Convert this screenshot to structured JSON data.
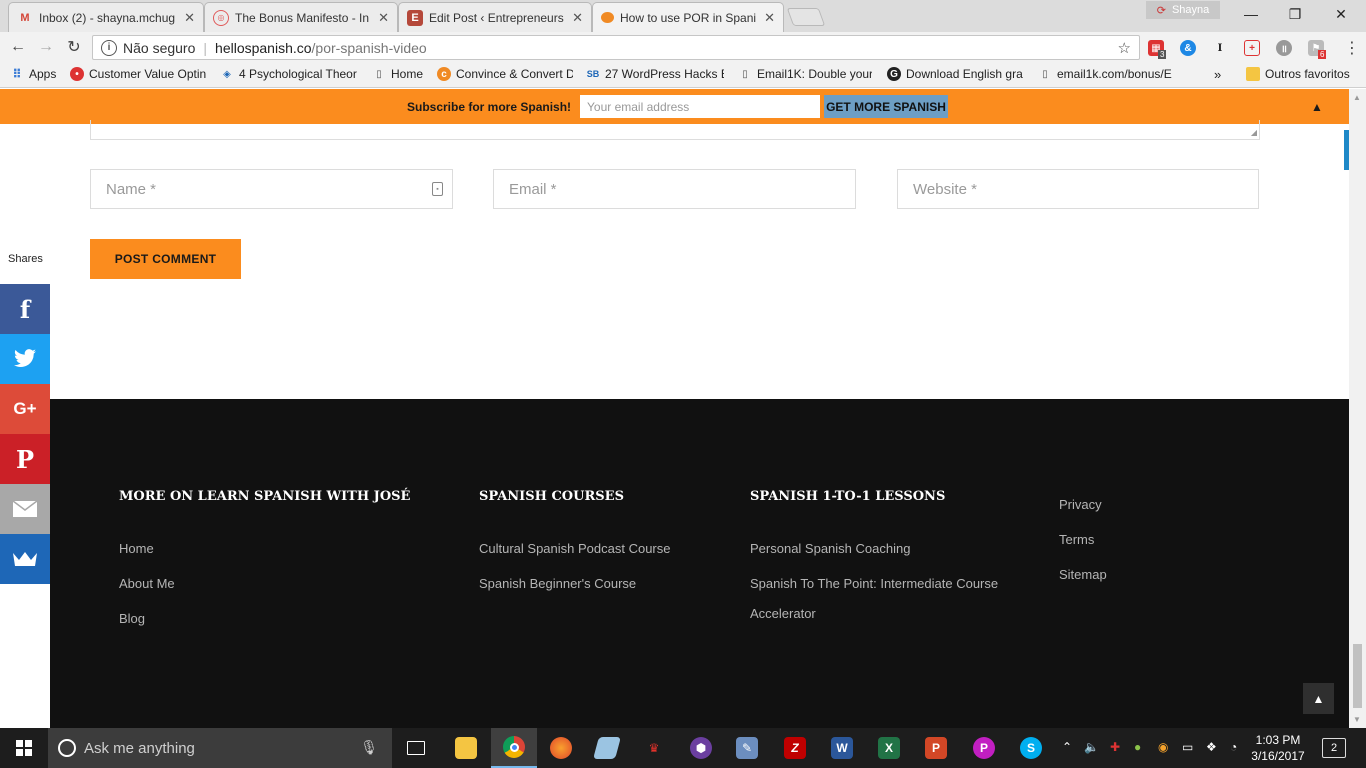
{
  "browser": {
    "tabs": [
      {
        "title": "Inbox (2) - shayna.mchug",
        "icon": "gmail-icon",
        "color": "#d44638"
      },
      {
        "title": "The Bonus Manifesto - In",
        "icon": "manifesto-icon",
        "color": "#e05a5a"
      },
      {
        "title": "Edit Post ‹ Entrepreneurs",
        "icon": "edit-post-icon",
        "color": "#b5483a"
      },
      {
        "title": "How to use POR in Spani",
        "icon": "hellospanish-icon",
        "color": "#f08a24"
      }
    ],
    "profile_name": "Shayna",
    "address": {
      "security": "Não seguro",
      "host": "hellospanish.co",
      "path": "/por-spanish-video"
    },
    "bookmarks": [
      {
        "label": "Apps"
      },
      {
        "label": "Customer Value Optin"
      },
      {
        "label": "4 Psychological Theor"
      },
      {
        "label": "Home"
      },
      {
        "label": "Convince & Convert D"
      },
      {
        "label": "27 WordPress Hacks E"
      },
      {
        "label": "Email1K: Double your"
      },
      {
        "label": "Download English gra"
      },
      {
        "label": "email1k.com/bonus/E"
      },
      {
        "label": "Outros favoritos"
      }
    ],
    "bookmark_overflow": "»",
    "extension_badges": {
      "first": "3",
      "last": "6"
    }
  },
  "hellobar": {
    "text": "Subscribe for more Spanish!",
    "email_placeholder": "Your email address",
    "button_label": "GET MORE SPANISH",
    "collapse_glyph": "▲"
  },
  "comment_form": {
    "name_placeholder": "Name *",
    "email_placeholder": "Email *",
    "website_placeholder": "Website *",
    "submit_label": "POST COMMENT"
  },
  "share_bar": {
    "label": "Shares",
    "buttons": [
      {
        "name": "facebook",
        "glyph": "f",
        "color": "#3b5998"
      },
      {
        "name": "twitter",
        "glyph": "🐦",
        "color": "#1da1f2"
      },
      {
        "name": "google-plus",
        "glyph": "G+",
        "color": "#dd4b39"
      },
      {
        "name": "pinterest",
        "glyph": "P",
        "color": "#cb2027"
      },
      {
        "name": "email",
        "glyph": "✉",
        "color": "#a8a8a8"
      },
      {
        "name": "sumo",
        "glyph": "♛",
        "color": "#1e67b7"
      }
    ]
  },
  "footer": {
    "columns": [
      {
        "heading": "MORE ON LEARN SPANISH WITH JOSÉ",
        "links": [
          "Home",
          "About Me",
          "Blog"
        ]
      },
      {
        "heading": "SPANISH COURSES",
        "links": [
          "Cultural Spanish Podcast Course",
          "Spanish Beginner's Course"
        ]
      },
      {
        "heading": "SPANISH 1-TO-1 LESSONS",
        "links": [
          "Personal Spanish Coaching",
          "Spanish To The Point: Intermediate Course",
          "Accelerator"
        ]
      },
      {
        "heading": "",
        "links": [
          "Privacy",
          "Terms",
          "Sitemap"
        ]
      }
    ]
  },
  "taskbar": {
    "search_placeholder": "Ask me anything",
    "time": "1:03 PM",
    "date": "3/16/2017",
    "notification_count": "2"
  },
  "colors": {
    "accent_orange": "#fb8c1e",
    "footer_bg": "#111111",
    "subscribe_button": "#6d9ec4"
  }
}
